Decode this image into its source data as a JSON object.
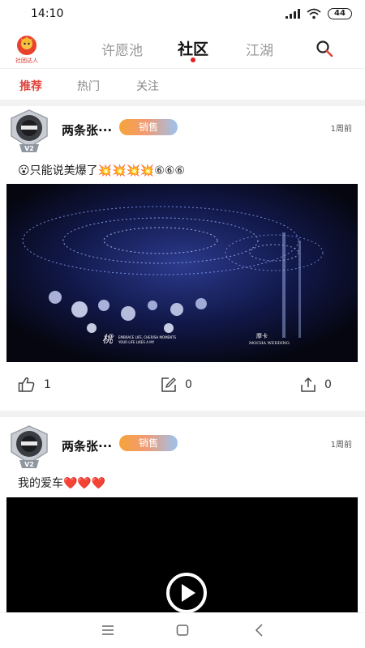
{
  "status_bar": {
    "time": "14:10",
    "battery": "44"
  },
  "logo": {
    "text": "社团达人"
  },
  "top_nav": {
    "tabs": [
      {
        "label": "许愿池",
        "active": false
      },
      {
        "label": "社区",
        "active": true
      },
      {
        "label": "江湖",
        "active": false
      }
    ]
  },
  "sub_tabs": [
    {
      "label": "推荐",
      "active": true
    },
    {
      "label": "热门",
      "active": false
    },
    {
      "label": "关注",
      "active": false
    }
  ],
  "posts": [
    {
      "author": "两条张···",
      "badge": "销售",
      "level": "V2",
      "time": "1周前",
      "text": "😮只能说美爆了💥💥💥💥⑥⑥⑥",
      "media_type": "image",
      "media_captions": {
        "left_logo": "桃",
        "left_line1": "EMBRACE LIFE, CHERISH MOMENTS",
        "left_line2": "YOUR LIFE LIKES A MY",
        "right_title": "摩卡",
        "right_line1": "MOCHA WEDDING"
      },
      "likes": "1",
      "comments": "0",
      "shares": "0"
    },
    {
      "author": "两条张···",
      "badge": "销售",
      "level": "V2",
      "time": "1周前",
      "text": "我的爱车❤️❤️❤️",
      "media_type": "video"
    }
  ]
}
